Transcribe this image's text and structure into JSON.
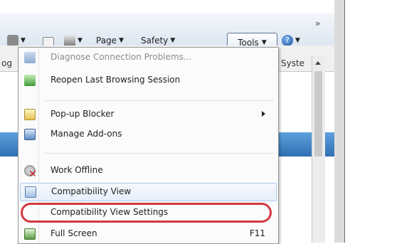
{
  "toolbar": {
    "page_label": "Page",
    "safety_label": "Safety",
    "tools_label": "Tools",
    "overflow_glyph": "»"
  },
  "background": {
    "left_tab_fragment": "og",
    "right_tab_fragment": "Syste"
  },
  "menu": {
    "items": [
      {
        "label": "Diagnose Connection Problems...",
        "disabled": true,
        "icon": "network-diagnose-icon"
      },
      {
        "label": "Reopen Last Browsing Session",
        "disabled": false,
        "icon": "reopen-session-icon"
      },
      {
        "label": "Pop-up Blocker",
        "disabled": false,
        "icon": "popup-blocker-icon",
        "submenu": true
      },
      {
        "label": "Manage Add-ons",
        "disabled": false,
        "icon": "addons-icon"
      },
      {
        "label": "Work Offline",
        "disabled": false,
        "icon": "work-offline-icon"
      },
      {
        "label": "Compatibility View",
        "disabled": false,
        "icon": "compatibility-view-icon"
      },
      {
        "label": "Compatibility View Settings",
        "disabled": false,
        "icon": "none"
      },
      {
        "label": "Full Screen",
        "disabled": false,
        "icon": "full-screen-icon",
        "shortcut": "F11"
      }
    ]
  },
  "colors": {
    "highlight_ring": "#d13940",
    "menu_border": "#979797",
    "hover_fill": "#e6eef9"
  }
}
